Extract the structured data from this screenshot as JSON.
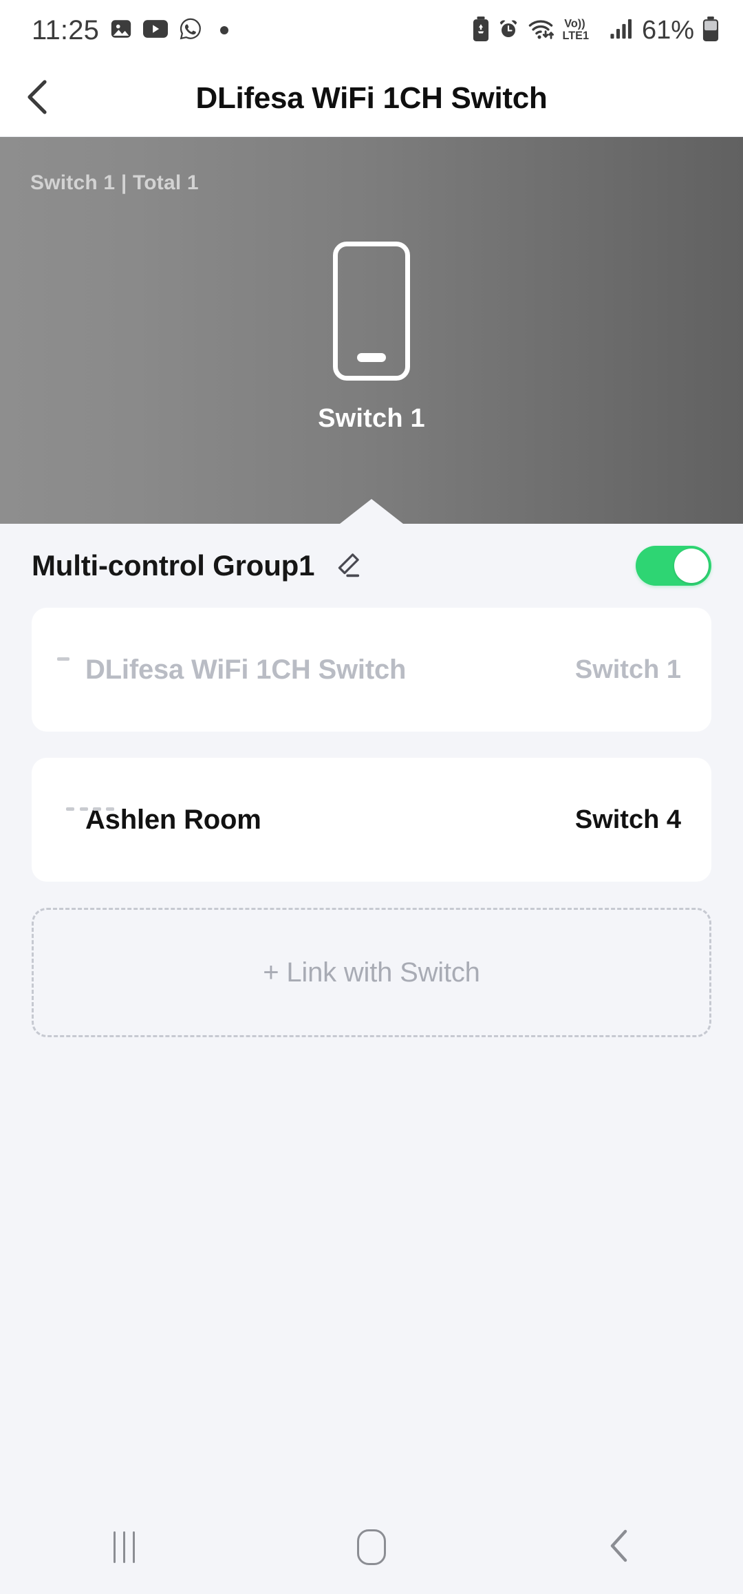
{
  "statusbar": {
    "time": "11:25",
    "battery_percent": "61%",
    "volte_label_top": "Vo))",
    "volte_label_bottom": "LTE1",
    "icons": [
      "gallery-icon",
      "youtube-icon",
      "whatsapp-icon",
      "notification-dot",
      "battery-saver-icon",
      "alarm-icon",
      "wifi-icon",
      "volte-icon",
      "signal-icon",
      "battery-icon"
    ]
  },
  "appbar": {
    "title": "DLifesa WiFi 1CH Switch",
    "back_icon": "back-chevron-icon"
  },
  "hero": {
    "meta": "Switch 1 | Total 1",
    "device_label": "Switch 1",
    "gradient_from": "#8e8e8e",
    "gradient_to": "#616161"
  },
  "group": {
    "title": "Multi-control Group1",
    "edit_icon": "pencil-edit-icon",
    "toggle_state": "on",
    "toggle_color": "#2ed573"
  },
  "devices": [
    {
      "name": "DLifesa WiFi 1CH Switch",
      "channel": "Switch 1",
      "state": "disabled",
      "thumb": "switch-1gang-thumb"
    },
    {
      "name": "Ashlen Room",
      "channel": "Switch 4",
      "state": "active",
      "thumb": "switch-4gang-thumb"
    }
  ],
  "link_button": {
    "label": "+ Link with Switch"
  },
  "navbar": {
    "recents": "recents-icon",
    "home": "home-icon",
    "back": "back-icon"
  }
}
